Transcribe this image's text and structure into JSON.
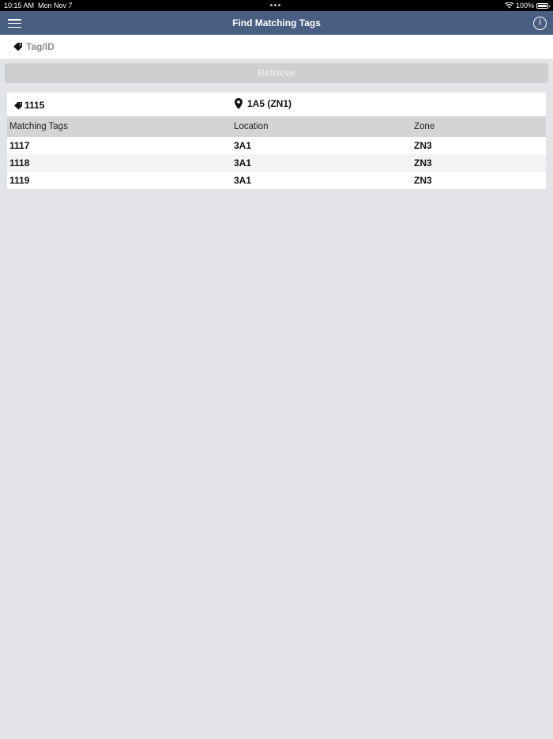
{
  "status_bar": {
    "time": "10:15 AM",
    "date": "Mon Nov 7",
    "battery": "100%",
    "battery_level": 1.0
  },
  "nav": {
    "title": "Find Matching Tags",
    "menu_icon": "hamburger-menu-icon",
    "info_icon": "info-icon",
    "info_glyph": "i"
  },
  "search": {
    "placeholder": "Tag/ID",
    "value": "",
    "icon": "tag-icon"
  },
  "retrieve": {
    "label": "Retrieve",
    "enabled": false
  },
  "result": {
    "tag": "1115",
    "location": "1A5 (ZN1)",
    "columns": [
      "Matching Tags",
      "Location",
      "Zone"
    ],
    "rows": [
      [
        "1117",
        "3A1",
        "ZN3"
      ],
      [
        "1118",
        "3A1",
        "ZN3"
      ],
      [
        "1119",
        "3A1",
        "ZN3"
      ]
    ]
  },
  "colors": {
    "nav_bar": "#495f82",
    "background": "#e3e4e8",
    "column_header": "#d4d4d6",
    "button_disabled": "#cfcfcf"
  }
}
